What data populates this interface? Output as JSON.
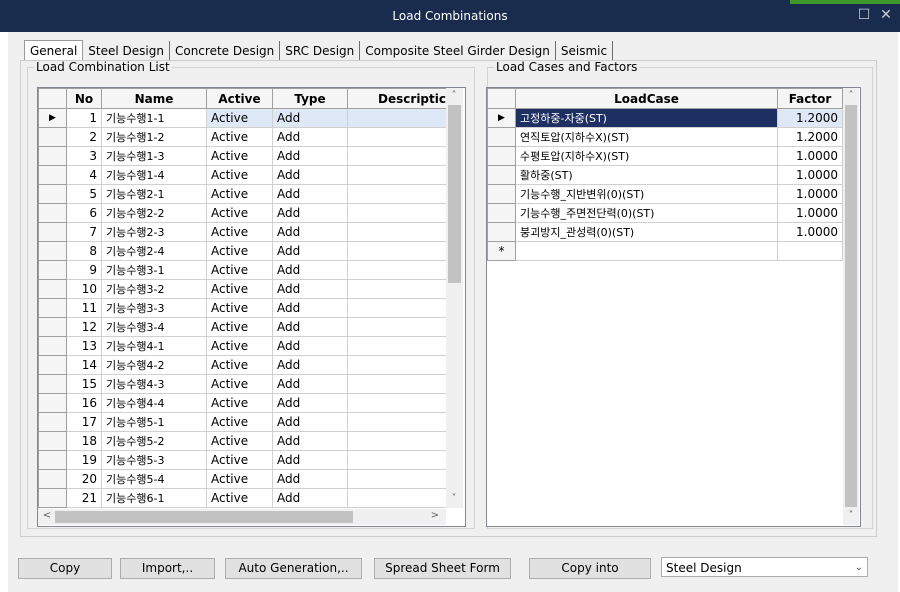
{
  "window": {
    "title": "Load Combinations",
    "minimize_icon": "☐",
    "close_icon": "✕"
  },
  "tabs": [
    "General",
    "Steel Design",
    "Concrete Design",
    "SRC Design",
    "Composite Steel Girder Design",
    "Seismic"
  ],
  "left": {
    "legend": "Load Combination List",
    "columns": [
      "No",
      "Name",
      "Active",
      "Type",
      "Descriptic"
    ],
    "rows": [
      {
        "no": "1",
        "name": "기능수행1-1",
        "active": "Active",
        "type": "Add"
      },
      {
        "no": "2",
        "name": "기능수행1-2",
        "active": "Active",
        "type": "Add"
      },
      {
        "no": "3",
        "name": "기능수행1-3",
        "active": "Active",
        "type": "Add"
      },
      {
        "no": "4",
        "name": "기능수행1-4",
        "active": "Active",
        "type": "Add"
      },
      {
        "no": "5",
        "name": "기능수행2-1",
        "active": "Active",
        "type": "Add"
      },
      {
        "no": "6",
        "name": "기능수행2-2",
        "active": "Active",
        "type": "Add"
      },
      {
        "no": "7",
        "name": "기능수행2-3",
        "active": "Active",
        "type": "Add"
      },
      {
        "no": "8",
        "name": "기능수행2-4",
        "active": "Active",
        "type": "Add"
      },
      {
        "no": "9",
        "name": "기능수행3-1",
        "active": "Active",
        "type": "Add"
      },
      {
        "no": "10",
        "name": "기능수행3-2",
        "active": "Active",
        "type": "Add"
      },
      {
        "no": "11",
        "name": "기능수행3-3",
        "active": "Active",
        "type": "Add"
      },
      {
        "no": "12",
        "name": "기능수행3-4",
        "active": "Active",
        "type": "Add"
      },
      {
        "no": "13",
        "name": "기능수행4-1",
        "active": "Active",
        "type": "Add"
      },
      {
        "no": "14",
        "name": "기능수행4-2",
        "active": "Active",
        "type": "Add"
      },
      {
        "no": "15",
        "name": "기능수행4-3",
        "active": "Active",
        "type": "Add"
      },
      {
        "no": "16",
        "name": "기능수행4-4",
        "active": "Active",
        "type": "Add"
      },
      {
        "no": "17",
        "name": "기능수행5-1",
        "active": "Active",
        "type": "Add"
      },
      {
        "no": "18",
        "name": "기능수행5-2",
        "active": "Active",
        "type": "Add"
      },
      {
        "no": "19",
        "name": "기능수행5-3",
        "active": "Active",
        "type": "Add"
      },
      {
        "no": "20",
        "name": "기능수행5-4",
        "active": "Active",
        "type": "Add"
      },
      {
        "no": "21",
        "name": "기능수행6-1",
        "active": "Active",
        "type": "Add"
      }
    ]
  },
  "right": {
    "legend": "Load Cases and Factors",
    "columns": [
      "LoadCase",
      "Factor"
    ],
    "rows": [
      {
        "loadcase": "고정하중-자중(ST)",
        "factor": "1.2000"
      },
      {
        "loadcase": "연직토압(지하수X)(ST)",
        "factor": "1.2000"
      },
      {
        "loadcase": "수평토압(지하수X)(ST)",
        "factor": "1.0000"
      },
      {
        "loadcase": "활하중(ST)",
        "factor": "1.0000"
      },
      {
        "loadcase": "기능수행_지반변위(0)(ST)",
        "factor": "1.0000"
      },
      {
        "loadcase": "기능수행_주면전단력(0)(ST)",
        "factor": "1.0000"
      },
      {
        "loadcase": "붕괴방지_관성력(0)(ST)",
        "factor": "1.0000"
      }
    ],
    "new_row_marker": "*"
  },
  "row_indicator": "▶",
  "buttons": {
    "copy": "Copy",
    "import": "Import,..",
    "auto_generation": "Auto Generation,..",
    "spread_sheet": "Spread Sheet Form",
    "copy_into": "Copy into"
  },
  "copy_target": {
    "value": "Steel Design"
  },
  "icons": {
    "scroll_up": "˄",
    "scroll_down": "˅",
    "scroll_left": "<",
    "scroll_right": ">",
    "dropdown": "⌄"
  }
}
